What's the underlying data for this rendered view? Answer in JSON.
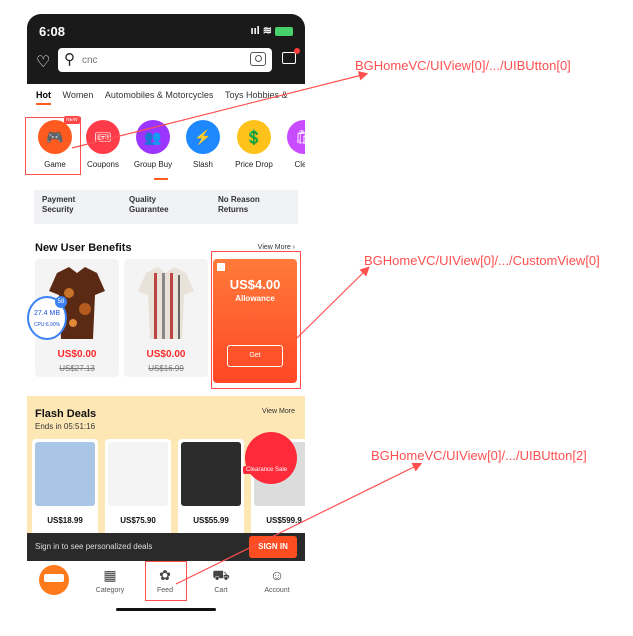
{
  "status": {
    "time": "6:08"
  },
  "search": {
    "placeholder": "cnc"
  },
  "tabs": [
    "Hot",
    "Women",
    "Automobiles & Motorcycles",
    "Toys Hobbies &"
  ],
  "categories": [
    {
      "label": "Game",
      "color": "#ff5a1f",
      "icon": "🎮",
      "badge": "NEW"
    },
    {
      "label": "Coupons",
      "color": "#ff3b4a",
      "icon": "🎟"
    },
    {
      "label": "Group Buy",
      "color": "#9b35ff",
      "icon": "👥"
    },
    {
      "label": "Slash",
      "color": "#1e88ff",
      "icon": "⚡"
    },
    {
      "label": "Price Drop",
      "color": "#ffc21a",
      "icon": "💲"
    },
    {
      "label": "Clear",
      "color": "#c84bff",
      "icon": "🛍"
    }
  ],
  "guarantees": [
    {
      "line1": "Payment",
      "line2": "Security"
    },
    {
      "line1": "Quality",
      "line2": "Guarantee"
    },
    {
      "line1": "No Reason",
      "line2": "Returns"
    }
  ],
  "new_user": {
    "title": "New User Benefits",
    "view_more": "View More ›",
    "products": [
      {
        "price": "US$0.00",
        "old": "US$27.13"
      },
      {
        "price": "US$0.00",
        "old": "US$16.99"
      }
    ],
    "allowance": {
      "amount": "US$4.00",
      "label": "Allowance",
      "button": "Get"
    }
  },
  "perf": {
    "mb": "27.4 MB",
    "cpu": "CPU:6.90%",
    "count": "58"
  },
  "flash": {
    "title": "Flash Deals",
    "ends": "Ends in 05:51:16",
    "view_more": "View More",
    "items": [
      {
        "price": "US$18.99"
      },
      {
        "price": "US$75.90"
      },
      {
        "price": "US$55.99"
      },
      {
        "price": "US$599.9"
      }
    ],
    "clearance": "Clearance Sale"
  },
  "signin": {
    "text": "Sign in to see personalized deals",
    "button": "SIGN IN"
  },
  "nav": [
    {
      "label": "Category",
      "icon": "◻"
    },
    {
      "label": "Feed",
      "icon": "🌀"
    },
    {
      "label": "Cart",
      "icon": "🛒"
    },
    {
      "label": "Account",
      "icon": "👤"
    }
  ],
  "annotations": {
    "a1": "BGHomeVC/UIView[0]/.../UIBUtton[0]",
    "a2": "BGHomeVC/UIView[0]/.../CustomView[0]",
    "a3": "BGHomeVC/UIView[0]/.../UIBUtton[2]"
  }
}
